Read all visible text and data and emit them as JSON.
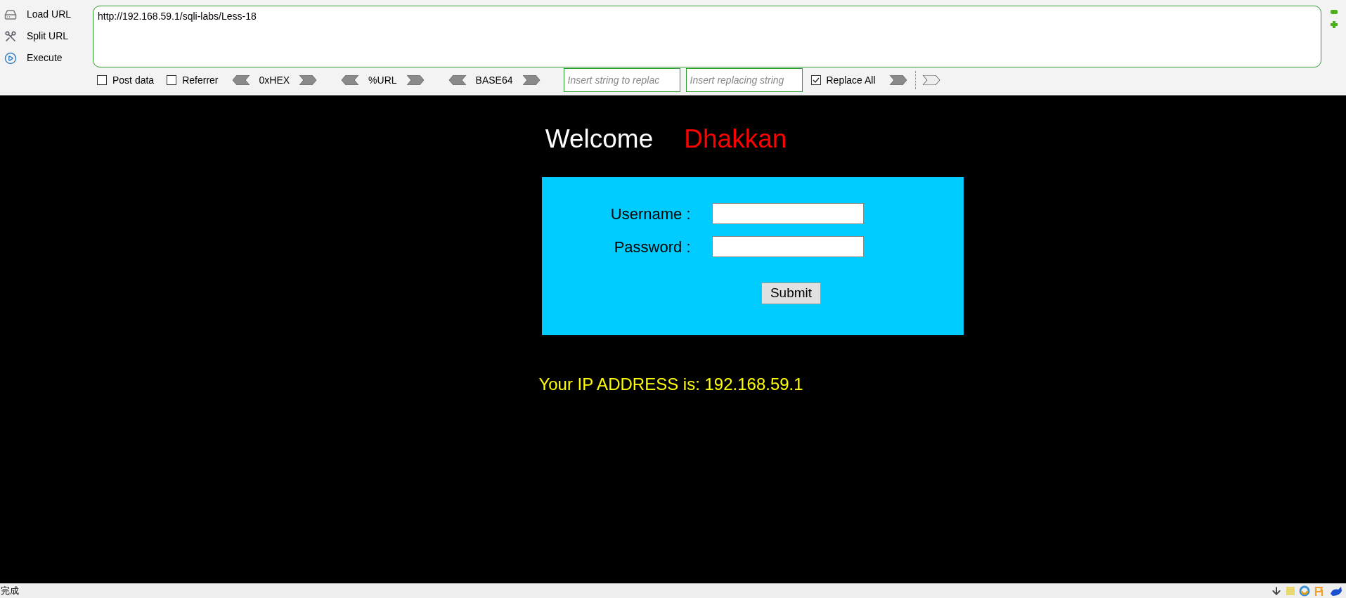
{
  "toolbar": {
    "buttons": [
      {
        "label": "Load URL",
        "kind": "load"
      },
      {
        "label": "Split URL",
        "kind": "split"
      },
      {
        "label": "Execute",
        "kind": "execute"
      }
    ],
    "url": "http://192.168.59.1/sqli-labs/Less-18",
    "options": [
      {
        "label": "Post data",
        "checked": false
      },
      {
        "label": "Referrer",
        "checked": false
      }
    ],
    "encoders": [
      "0xHEX",
      "%URL",
      "BASE64"
    ],
    "replace_fields": [
      {
        "placeholder": "Insert string to replac"
      },
      {
        "placeholder": "Insert replacing string"
      }
    ],
    "replace_all": {
      "label": "Replace All",
      "checked": true
    }
  },
  "page": {
    "welcome": "Welcome",
    "name": "Dhakkan",
    "fields": [
      {
        "label": "Username :"
      },
      {
        "label": "Password :"
      }
    ],
    "submit": "Submit",
    "ip_text": "Your IP ADDRESS is: 192.168.59.1"
  },
  "status_bar": {
    "text": "完成"
  }
}
